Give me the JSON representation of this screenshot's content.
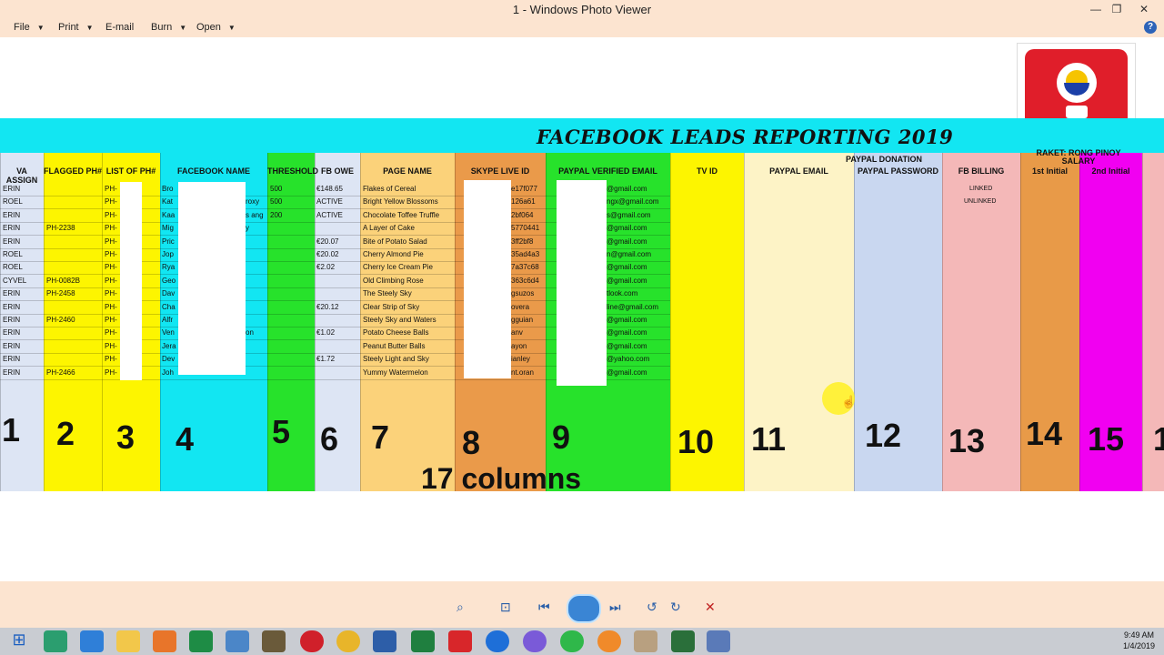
{
  "window": {
    "title": "1 - Windows Photo Viewer",
    "min": "—",
    "max": "❐",
    "close": "✕"
  },
  "menu": [
    {
      "label": "File"
    },
    {
      "label": "Print"
    },
    {
      "label": "E-mail"
    },
    {
      "label": "Burn"
    },
    {
      "label": "Open"
    }
  ],
  "help": "?",
  "sheet": {
    "title": "FACEBOOK LEADS REPORTING 2019",
    "top_headers": {
      "paypal_donation": "PAYPAL DONATION",
      "salary": "RAKET: RONG PINOY SALARY"
    },
    "headers": [
      "VA ASSIGN",
      "FLAGGED PH#",
      "LIST OF PH#",
      "FACEBOOK NAME",
      "THRESHOLD",
      "FB OWE",
      "PAGE NAME",
      "SKYPE LIVE ID",
      "PAYPAL VERIFIED EMAIL",
      "TV ID",
      "PAYPAL EMAIL",
      "PAYPAL PASSWORD",
      "FB BILLING",
      "1st Initial",
      "2nd Initial"
    ],
    "va_assign": [
      "ERIN",
      "ROEL",
      "ERIN",
      "ERIN",
      "ERIN",
      "ROEL",
      "ROEL",
      "CYVEL",
      "ERIN",
      "ERIN",
      "ERIN",
      "ERIN",
      "ERIN",
      "ERIN",
      "ERIN"
    ],
    "flagged": [
      "",
      "",
      "",
      "PH-2238",
      "",
      "",
      "",
      "PH-0082B",
      "PH-2458",
      "",
      "PH-2460",
      "",
      "",
      "",
      "PH-2466"
    ],
    "list_ph": [
      "PH-",
      "PH-",
      "PH-",
      "PH-",
      "PH-",
      "PH-",
      "PH-",
      "PH-",
      "PH-",
      "PH-",
      "PH-",
      "PH-",
      "PH-",
      "PH-",
      "PH-"
    ],
    "fb_name": [
      "Bro",
      "Kat",
      "Kaa",
      "Mig",
      "Pric",
      "Jop",
      "Rya",
      "Geo",
      "Dav",
      "Cha",
      "Alfr",
      "Ven",
      "Jera",
      "Dev",
      "Joh"
    ],
    "fb_name_right": [
      "",
      "roxy",
      "s ang",
      "y",
      "",
      "",
      "",
      "",
      "",
      "",
      "",
      "on",
      "",
      "",
      ""
    ],
    "threshold": [
      "500",
      "500",
      "200",
      "",
      "",
      "",
      "",
      "",
      "",
      "",
      "",
      "",
      "",
      "",
      ""
    ],
    "fb_owe": [
      "€148.65",
      "ACTIVE",
      "ACTIVE",
      "",
      "€20.07",
      "€20.02",
      "€2.02",
      "",
      "",
      "€20.12",
      "",
      "€1.02",
      "",
      "€1.72",
      ""
    ],
    "page_name": [
      "Flakes of Cereal",
      "Bright Yellow Blossoms",
      "Chocolate Toffee Truffle",
      "A Layer of Cake",
      "Bite of Potato Salad",
      "Cherry Almond Pie",
      "Cherry Ice Cream Pie",
      "Old Climbing Rose",
      "The Steely Sky",
      "Clear Strip of Sky",
      "Steely Sky and Waters",
      "Potato Cheese Balls",
      "Peanut Butter Balls",
      "Steely Light and Sky",
      "Yummy Watermelon"
    ],
    "skype": [
      "e17f077",
      "126a61",
      "2bf064",
      "5770441",
      "3ff2bf8",
      "35ad4a3",
      "7a37c68",
      "363c6d4",
      "gsuzos",
      "overa",
      "gguian",
      "anv",
      "ayon",
      "ianley",
      "nt.oran"
    ],
    "paypal_verified": [
      "@gmail.com",
      "ngx@gmail.com",
      "s@gmail.com",
      "@gmail.com",
      "@gmail.com",
      "n@gmail.com",
      "@gmail.com",
      "@gmail.com",
      "tlook.com",
      "line@gmail.com",
      "@gmail.com",
      "@gmail.com",
      "@gmail.com",
      "@yahoo.com",
      "@gmail.com"
    ],
    "fb_billing": [
      "LINKED",
      "UNLINKED"
    ],
    "numbers": [
      "1",
      "2",
      "3",
      "4",
      "5",
      "6",
      "7",
      "8",
      "9",
      "10",
      "11",
      "12",
      "13",
      "14",
      "15",
      "1"
    ],
    "columns_label": "17 columns",
    "colors": {
      "cyan": "#12e6f2",
      "yellow": "#fdf500",
      "green": "#27e22b",
      "orange": "#f0a040",
      "peach": "#fbd27a",
      "pink": "#f4b8b8",
      "blue": "#c9d7f0",
      "magenta": "#f100f1",
      "cream": "#fdf3c6",
      "light": "#dde5f4"
    }
  },
  "viewer_toolbar": {
    "zoom": "⌕",
    "fit": "⊡",
    "prev": "⏮",
    "next": "⏭",
    "rotate_left": "↺",
    "rotate_right": "↻",
    "delete": "✕"
  },
  "clock": {
    "time": "9:49 AM",
    "date": "1/4/2019"
  }
}
